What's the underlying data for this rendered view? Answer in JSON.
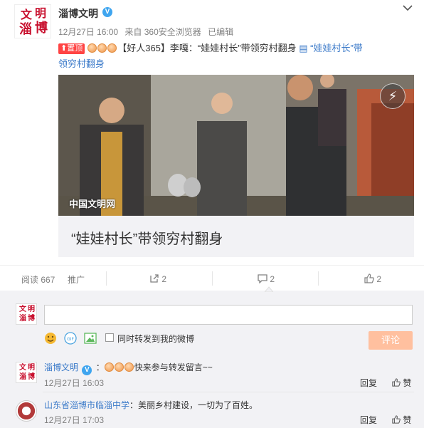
{
  "post": {
    "username": "淄博文明",
    "verified_mark": "V",
    "timestamp": "12月27日 16:00",
    "source": "来自 360安全浏览器",
    "edited": "已编辑",
    "pin_label": "置顶",
    "text_prefix": "【好人365】李嘎：“娃娃村长”带领穷村翻身",
    "topic_link_prefix": "“娃娃村长”带",
    "topic_link_suffix": "领穷村翻身",
    "media_watermark": "中国文明网",
    "card_caption": "“娃娃村长”带领穷村翻身"
  },
  "logo": {
    "chars": [
      "文",
      "明",
      "淄",
      "博"
    ]
  },
  "actions": {
    "reads": "阅读 667",
    "promote": "推广",
    "forward_count": "2",
    "comment_count": "2",
    "like_count": "2"
  },
  "composer": {
    "sync_label": "同时转发到我的微博",
    "submit_label": "评论"
  },
  "comments": [
    {
      "user": "淄博文明",
      "text": "快来参与转发留言~~",
      "time": "12月27日 16:03",
      "reply": "回复",
      "like": "赞"
    },
    {
      "user": "山东省淄博市临淄中学",
      "text": "：美丽乡村建设，一切为了百姓。",
      "time": "12月27日 17:03",
      "reply": "回复",
      "like": "赞"
    }
  ],
  "colors": {
    "accent": "#3b7ac9",
    "logo_red": "#c8102e",
    "submit_bg": "#ffc09f",
    "pin_bg": "#ff4444"
  },
  "icons": [
    "chevron-down-icon",
    "verified-icon",
    "play-icon",
    "forward-icon",
    "comment-icon",
    "like-icon",
    "smile-icon",
    "gif-icon",
    "image-icon"
  ]
}
